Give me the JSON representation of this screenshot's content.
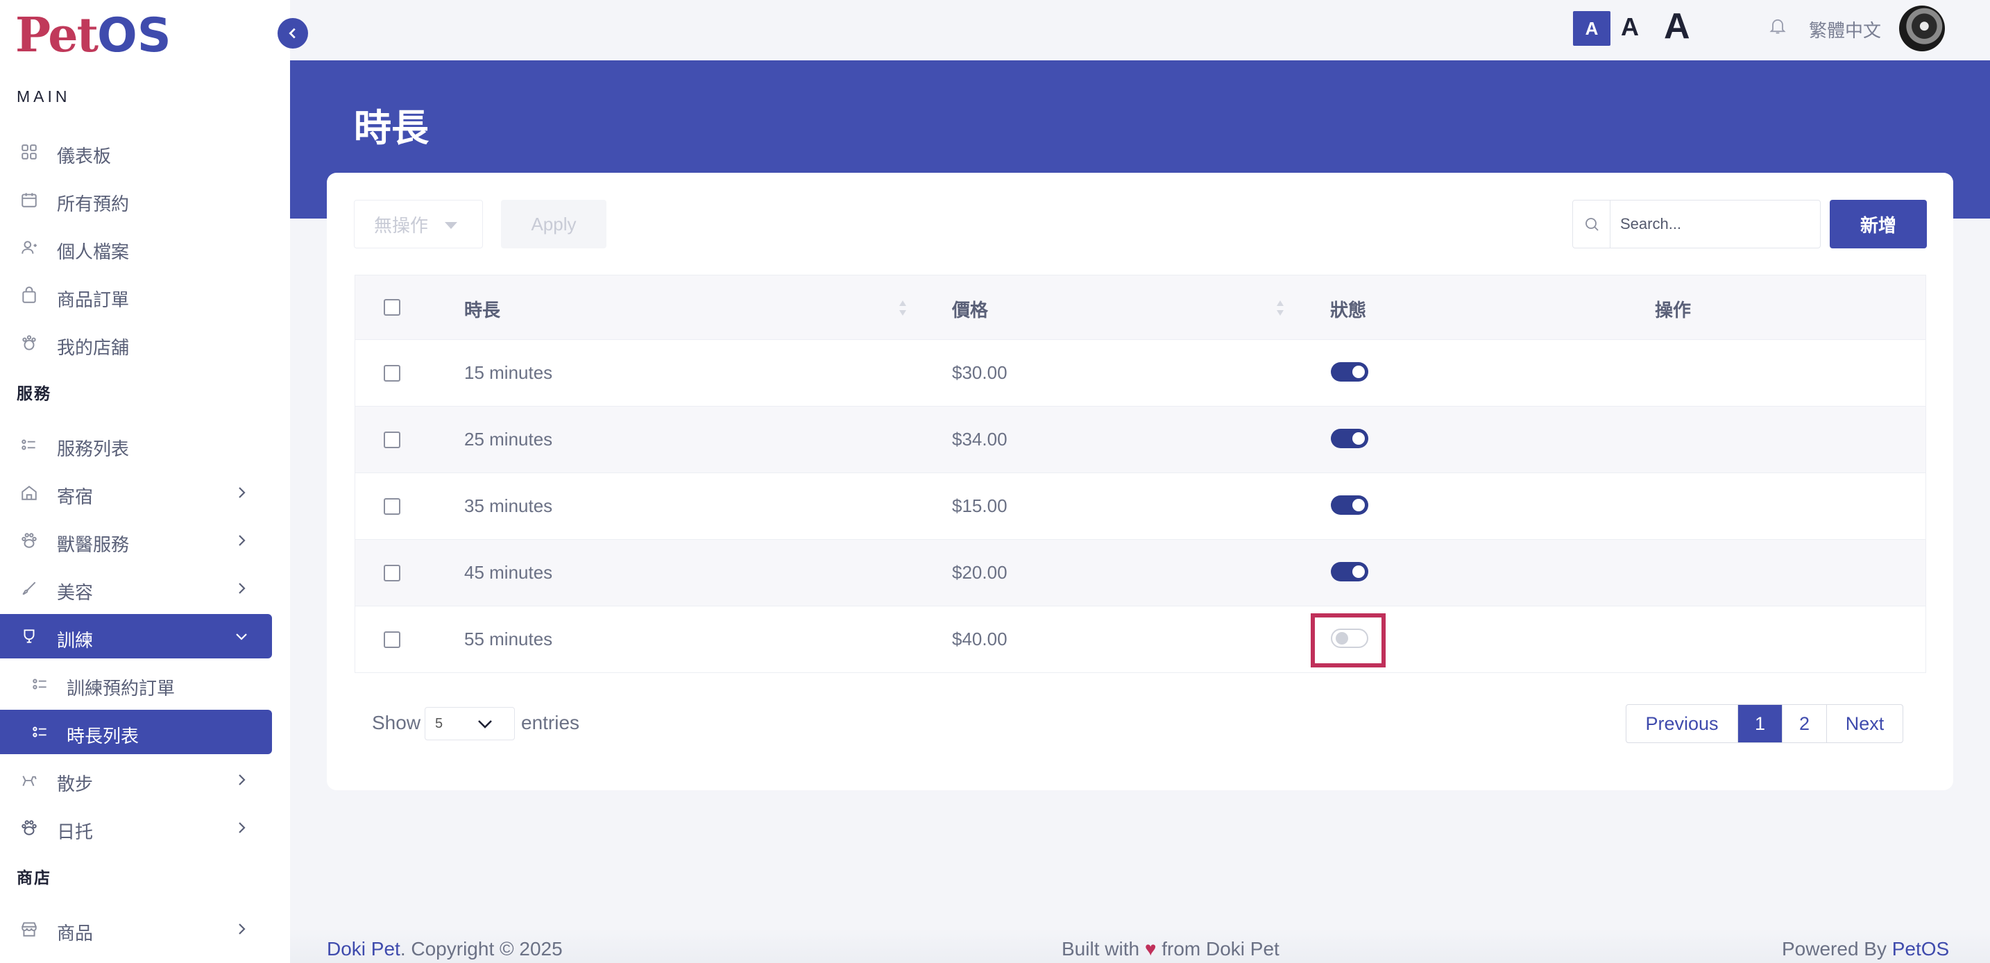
{
  "brand": {
    "logo_part1": "Pet",
    "logo_part2": "OS"
  },
  "sidebar": {
    "section_main": "MAIN",
    "main_items": [
      {
        "label": "儀表板",
        "icon": "dashboard-grid-icon"
      },
      {
        "label": "所有預約",
        "icon": "calendar-icon"
      },
      {
        "label": "個人檔案",
        "icon": "user-profile-icon"
      },
      {
        "label": "商品訂單",
        "icon": "shopping-bag-icon"
      },
      {
        "label": "我的店舖",
        "icon": "paw-store-icon"
      }
    ],
    "section_services": "服務",
    "service_items": [
      {
        "label": "服務列表",
        "icon": "list-icon"
      },
      {
        "label": "寄宿",
        "icon": "home-icon"
      },
      {
        "label": "獸醫服務",
        "icon": "paw-icon"
      },
      {
        "label": "美容",
        "icon": "brush-icon"
      },
      {
        "label": "訓練",
        "icon": "training-icon"
      },
      {
        "label": "訓練預約訂單",
        "icon": "list-icon"
      },
      {
        "label": "時長列表",
        "icon": "list-icon"
      },
      {
        "label": "散步",
        "icon": "dog-walk-icon"
      },
      {
        "label": "日托",
        "icon": "paw-icon"
      }
    ],
    "section_shop": "商店",
    "shop_items": [
      {
        "label": "商品",
        "icon": "store-icon"
      }
    ]
  },
  "topbar": {
    "font_small": "A",
    "font_medium": "A",
    "font_large": "A",
    "language": "繁體中文"
  },
  "page": {
    "title": "時長"
  },
  "toolbar": {
    "bulk_action": "無操作",
    "apply": "Apply",
    "search_placeholder": "Search...",
    "add": "新增"
  },
  "table": {
    "headers": {
      "duration": "時長",
      "price": "價格",
      "status": "狀態",
      "actions": "操作"
    },
    "rows": [
      {
        "duration": "15 minutes",
        "price": "$30.00",
        "enabled": true
      },
      {
        "duration": "25 minutes",
        "price": "$34.00",
        "enabled": true
      },
      {
        "duration": "35 minutes",
        "price": "$15.00",
        "enabled": true
      },
      {
        "duration": "45 minutes",
        "price": "$20.00",
        "enabled": true
      },
      {
        "duration": "55 minutes",
        "price": "$40.00",
        "enabled": false
      }
    ]
  },
  "length_menu": {
    "show": "Show",
    "value": "5",
    "entries": "entries"
  },
  "pagination": {
    "previous": "Previous",
    "page1": "1",
    "page2": "2",
    "next": "Next",
    "current": 1
  },
  "footer": {
    "company": "Doki Pet",
    "copyright": ". Copyright © 2025",
    "built_prefix": "Built with",
    "built_suffix": "from Doki Pet",
    "powered_prefix": "Powered By",
    "powered_brand": "PetOS"
  },
  "colors": {
    "primary": "#3f4bad",
    "header_band": "#424fb0",
    "highlight": "#c0305a",
    "logo_red": "#c0395a"
  }
}
